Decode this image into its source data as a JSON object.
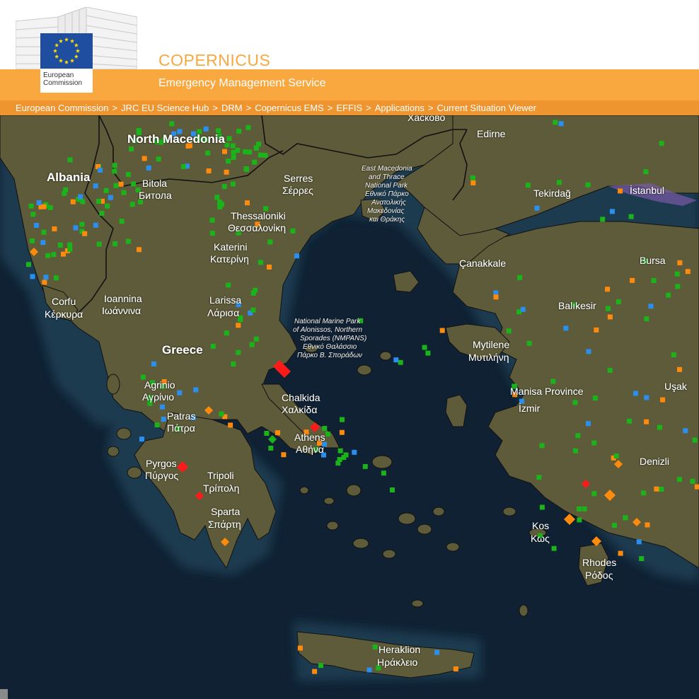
{
  "header": {
    "title": "COPERNICUS",
    "subtitle": "Emergency Management Service",
    "logo": {
      "line1": "European",
      "line2": "Commission",
      "flag_icon": "eu-flag-icon",
      "flag_blue": "#1f4ea1",
      "star_yellow": "#ffdd00"
    },
    "brand_orange": "#f9a83f"
  },
  "breadcrumb": [
    "European Commission",
    "JRC EU Science Hub",
    "DRM",
    "Copernicus EMS",
    "EFFIS",
    "Applications",
    "Current Situation Viewer"
  ],
  "breadcrumb_separator": ">",
  "map": {
    "labels": {
      "haskovo": "Хасково",
      "edirne": "Edirne",
      "north_macedonia": "North Macedonia",
      "albania": "Albania",
      "bitola": "Bitola",
      "bitola_cyr": "Битола",
      "serres": "Serres",
      "serres_gr": "Σέρρες",
      "emt_1": "East Macedonia",
      "emt_2": "and Thrace",
      "emt_3": "National Park",
      "emt_4": "Εθνικό Πάρκο",
      "emt_5": "Ανατολικής",
      "emt_6": "Μακεδονίας",
      "emt_7": "και Θράκης",
      "tekirdag": "Tekirdağ",
      "istanbul": "İstanbul",
      "thessaloniki": "Thessaloniki",
      "thessaloniki_gr": "Θεσσαλονίκη",
      "katerini": "Katerini",
      "katerini_gr": "Κατερίνη",
      "canakkale": "Çanakkale",
      "bursa": "Bursa",
      "ioannina": "Ioannina",
      "ioannina_gr": "Ιωάννινα",
      "corfu": "Corfu",
      "corfu_gr": "Κέρκυρα",
      "larissa": "Larissa",
      "larissa_gr": "Λάρισα",
      "nmp_1": "National Marine Park",
      "nmp_2": "of Alonissos, Northern",
      "nmp_3": "Sporades (NMPANS)",
      "nmp_4": "Εθνικό Θαλάσσιο",
      "nmp_5": "Πάρκο Β. Σποράδων",
      "balikesir": "Balıkesir",
      "greece": "Greece",
      "mytilene": "Mytilene",
      "mytilene_gr": "Μυτιλήνη",
      "agrinio": "Agrinio",
      "agrinio_gr": "Αγρίνιο",
      "chalkida": "Chalkida",
      "chalkida_gr": "Χαλκίδα",
      "manisa": "Manisa Province",
      "usak": "Uşak",
      "izmir": "İzmir",
      "patras": "Patras",
      "patras_gr": "Πάτρα",
      "athens": "Athens",
      "athens_gr": "Αθήνα",
      "pyrgos": "Pyrgos",
      "pyrgos_gr": "Πύργος",
      "tripoli": "Tripoli",
      "tripoli_gr": "Τρίπολη",
      "denizli": "Denizli",
      "sparta": "Sparta",
      "sparta_gr": "Σπάρτη",
      "kos": "Kos",
      "kos_gr": "Κως",
      "rhodes": "Rhodes",
      "rhodes_gr": "Ρόδος",
      "heraklion": "Heraklion",
      "heraklion_gr": "Ηράκλειο"
    },
    "colors": {
      "sea": "#0f2133",
      "shallow": "#1e3a4f",
      "land": "#5d5b39",
      "border": "#111111",
      "hotspot_green": "#1ab31a",
      "hotspot_blue": "#2b8ff0",
      "hotspot_orange": "#ff8a0c",
      "hotspot_red": "#ff1a1a"
    }
  }
}
